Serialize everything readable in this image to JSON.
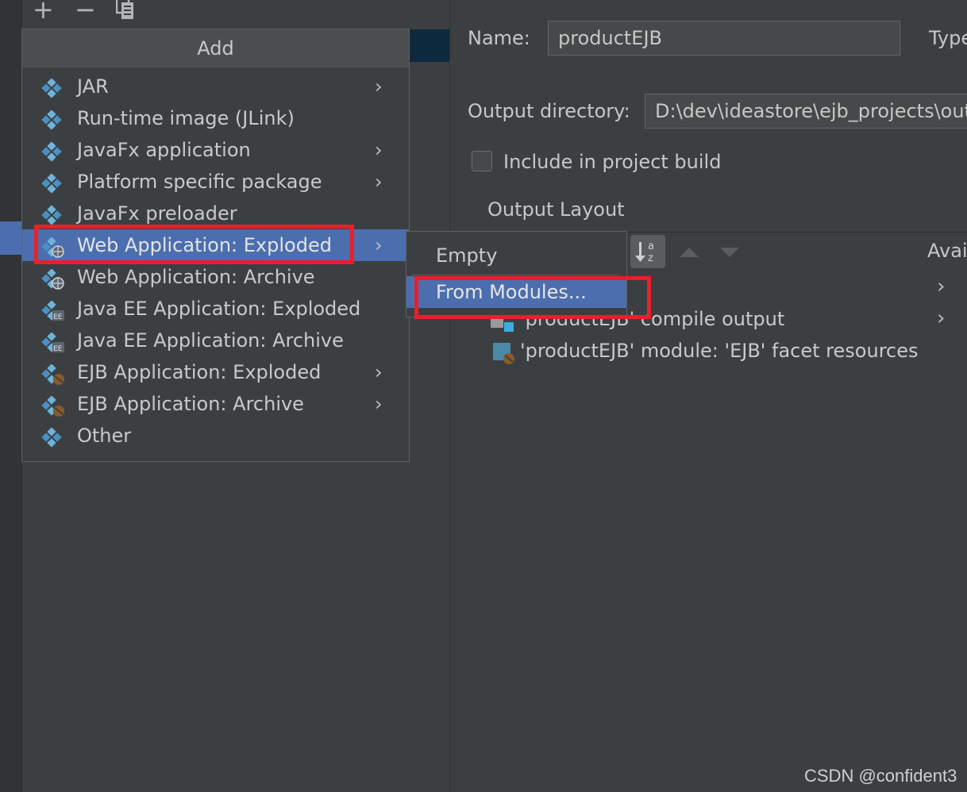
{
  "toolbar": {
    "add_symbol": "+",
    "remove_symbol": "−"
  },
  "add_menu": {
    "title": "Add",
    "items": [
      {
        "label": "JAR",
        "icon": "artifact-icon",
        "submenu": true
      },
      {
        "label": "Run-time image (JLink)",
        "icon": "artifact-icon",
        "submenu": false
      },
      {
        "label": "JavaFx application",
        "icon": "artifact-icon",
        "submenu": true
      },
      {
        "label": "Platform specific package",
        "icon": "artifact-icon",
        "submenu": true
      },
      {
        "label": "JavaFx preloader",
        "icon": "artifact-icon",
        "submenu": false
      },
      {
        "label": "Web Application: Exploded",
        "icon": "web-artifact-icon",
        "submenu": true,
        "selected": true
      },
      {
        "label": "Web Application: Archive",
        "icon": "web-artifact-icon",
        "submenu": false
      },
      {
        "label": "Java EE Application: Exploded",
        "icon": "javaee-artifact-icon",
        "submenu": false
      },
      {
        "label": "Java EE Application: Archive",
        "icon": "javaee-artifact-icon",
        "submenu": false
      },
      {
        "label": "EJB Application: Exploded",
        "icon": "ejb-artifact-icon",
        "submenu": true
      },
      {
        "label": "EJB Application: Archive",
        "icon": "ejb-artifact-icon",
        "submenu": true
      },
      {
        "label": "Other",
        "icon": "artifact-icon",
        "submenu": false
      }
    ],
    "chevron": "›"
  },
  "submenu": {
    "items": [
      {
        "label": "Empty",
        "selected": false
      },
      {
        "label": "From Modules...",
        "selected": true
      }
    ]
  },
  "form": {
    "name_label": "Name:",
    "name_value": "productEJB",
    "type_label": "Type",
    "output_dir_label": "Output directory:",
    "output_dir_value": "D:\\dev\\ideastore\\ejb_projects\\out\\",
    "include_build_label": "Include in project build",
    "include_build_checked": false,
    "output_layout_label": "Output Layout",
    "available_label": "Avai"
  },
  "tree": {
    "items": [
      {
        "label": "'productEJB' compile output",
        "icon": "module-output-icon"
      },
      {
        "label": "'productEJB' module: 'EJB' facet resources",
        "icon": "facet-resources-icon"
      }
    ]
  },
  "colors": {
    "selection": "#4b6eaf",
    "highlight": "#e8202a",
    "background": "#3c3f41"
  },
  "watermark": "CSDN @confident3"
}
